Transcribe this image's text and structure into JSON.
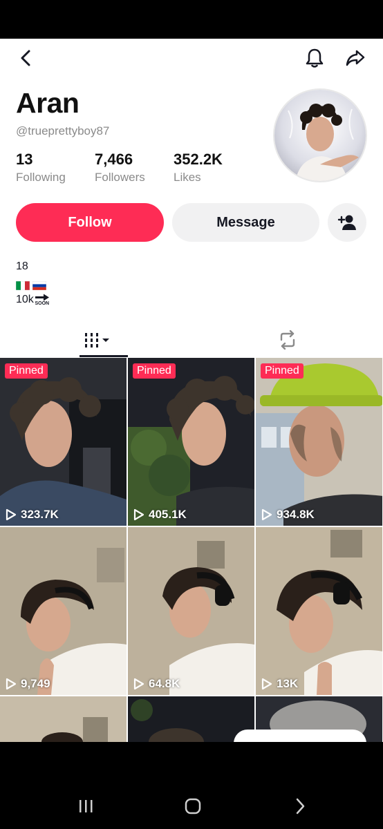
{
  "profile": {
    "name": "Aran",
    "handle": "@trueprettyboy87"
  },
  "stats": [
    {
      "value": "13",
      "label": "Following"
    },
    {
      "value": "7,466",
      "label": "Followers"
    },
    {
      "value": "352.2K",
      "label": "Likes"
    }
  ],
  "actions": {
    "follow_label": "Follow",
    "message_label": "Message"
  },
  "bio": {
    "age": "18",
    "followers_goal": "10k",
    "soon_label": "SOON"
  },
  "videos": [
    {
      "pinned": "Pinned",
      "views": "323.7K"
    },
    {
      "pinned": "Pinned",
      "views": "405.1K"
    },
    {
      "pinned": "Pinned",
      "views": "934.8K"
    },
    {
      "pinned": "",
      "views": "9,749"
    },
    {
      "pinned": "",
      "views": "64.8K"
    },
    {
      "pinned": "",
      "views": "13K"
    }
  ],
  "colors": {
    "accent": "#fe2c55",
    "secondary_button": "#f1f1f2",
    "muted_text": "#8a8a8a"
  },
  "icons": [
    "back-icon",
    "bell-icon",
    "share-icon",
    "add-user-icon",
    "grid-icon",
    "repost-icon",
    "play-icon",
    "recent-apps-icon",
    "home-icon",
    "back-nav-icon"
  ]
}
